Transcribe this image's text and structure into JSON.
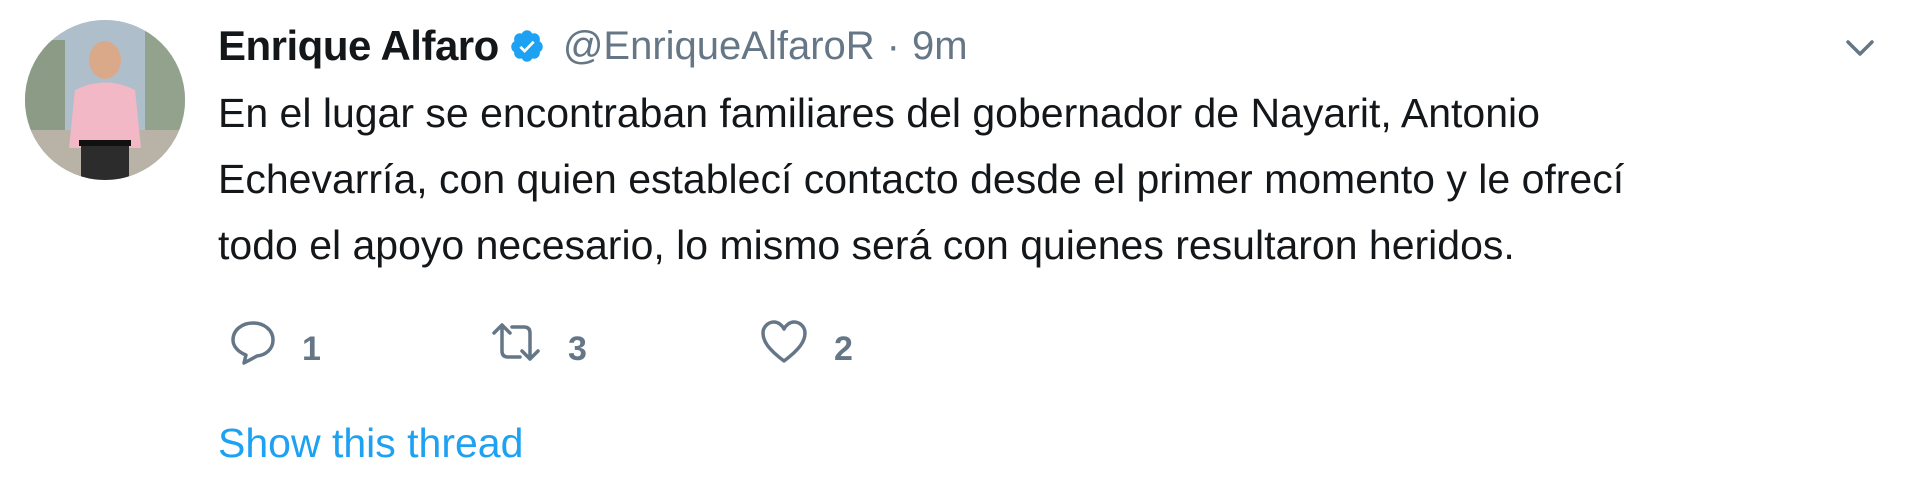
{
  "tweet": {
    "author_name": "Enrique Alfaro",
    "handle": "@EnriqueAlfaroR",
    "separator": "·",
    "time": "9m",
    "text_lines": [
      "En el lugar se encontraban familiares del gobernador de Nayarit, Antonio",
      "Echevarría, con quien establecí contacto desde el primer momento y le ofrecí",
      "todo el apoyo necesario, lo mismo será con quienes resultaron heridos."
    ],
    "actions": {
      "replies": "1",
      "retweets": "3",
      "likes": "2"
    },
    "show_thread": "Show this thread"
  },
  "icons": {
    "avatar": "profile-photo",
    "verified": "verified-badge-icon",
    "caret": "chevron-down-icon",
    "reply": "reply-icon",
    "retweet": "retweet-icon",
    "like": "heart-icon"
  },
  "colors": {
    "text": "#14171a",
    "secondary": "#657786",
    "accent": "#1da1f2"
  }
}
